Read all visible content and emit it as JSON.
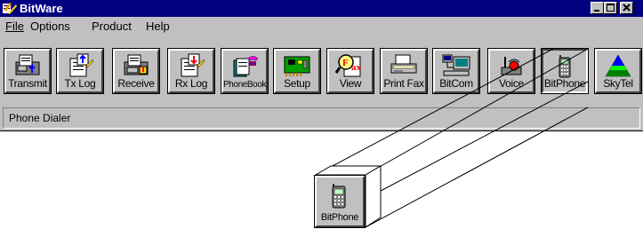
{
  "window": {
    "title": "BitWare"
  },
  "menu": [
    "File",
    "Options",
    "Product",
    "Help"
  ],
  "toolbar": {
    "buttons": [
      {
        "label": "Transmit",
        "icon": "fax-transmit-icon"
      },
      {
        "label": "Tx Log",
        "icon": "tx-log-icon"
      },
      {
        "label": "Receive",
        "icon": "fax-receive-icon"
      },
      {
        "label": "Rx Log",
        "icon": "rx-log-icon"
      },
      {
        "label": "PhoneBook",
        "icon": "phonebook-icon"
      },
      {
        "label": "Setup",
        "icon": "setup-card-icon"
      },
      {
        "label": "View",
        "icon": "view-fax-icon"
      },
      {
        "label": "Print Fax",
        "icon": "print-fax-icon"
      },
      {
        "label": "BitCom",
        "icon": "computer-icon"
      },
      {
        "label": "Voice",
        "icon": "voice-icon"
      },
      {
        "label": "BitPhone",
        "icon": "cell-phone-icon",
        "pressed": true
      },
      {
        "label": "SkyTel",
        "icon": "skytel-pyramid-icon"
      }
    ]
  },
  "status": {
    "text": "Phone Dialer"
  },
  "callout": {
    "label": "BitPhone",
    "icon": "cell-phone-icon"
  },
  "colors": {
    "titlebar": "#010080",
    "face": "#c0c0c0"
  }
}
